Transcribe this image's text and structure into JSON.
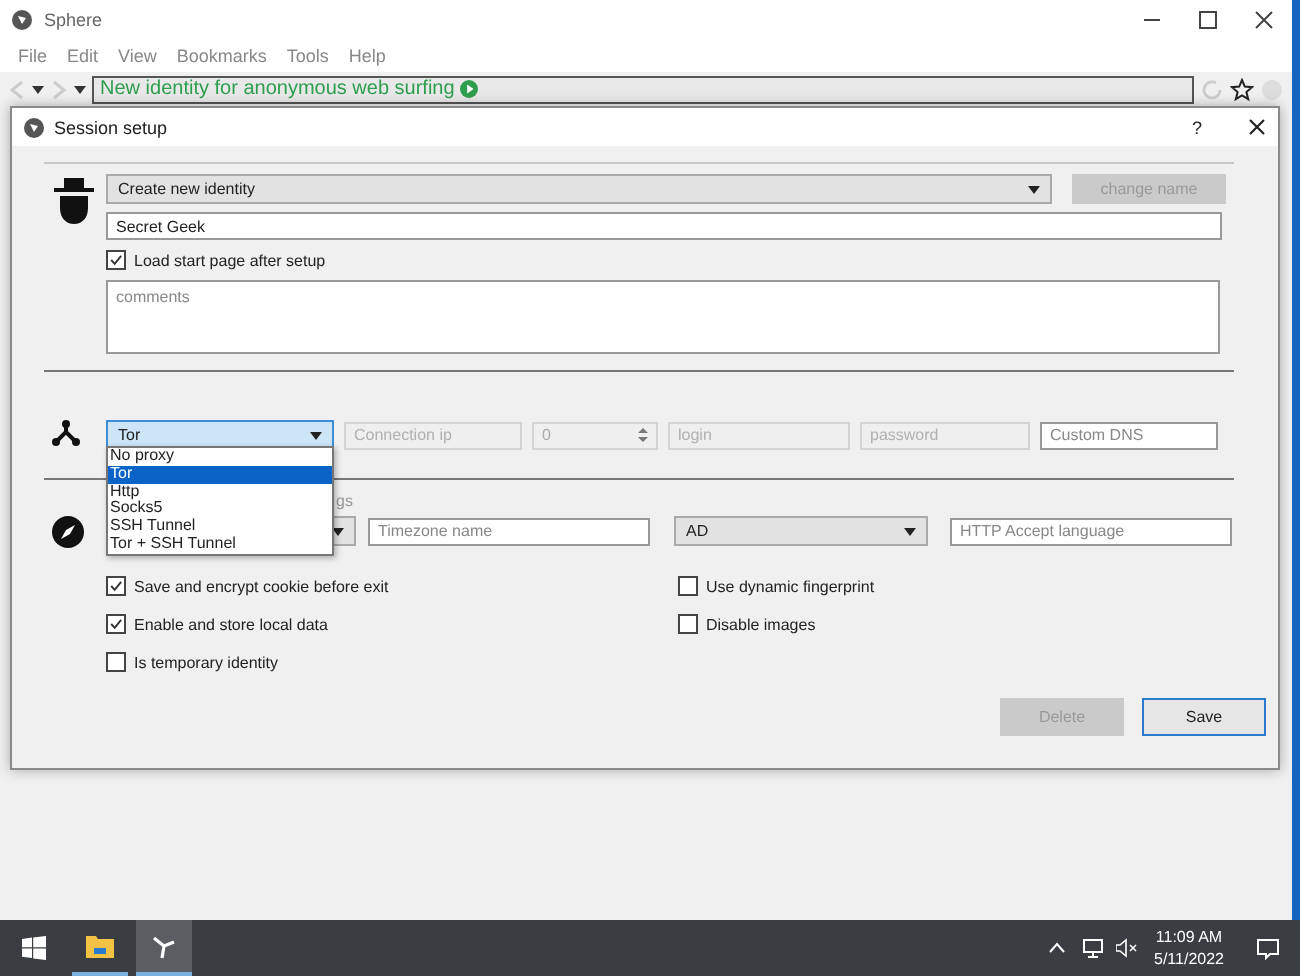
{
  "browser": {
    "title": "Sphere",
    "menu": [
      "File",
      "Edit",
      "View",
      "Bookmarks",
      "Tools",
      "Help"
    ],
    "address": "New identity for anonymous web surfing"
  },
  "dialog": {
    "title": "Session setup",
    "help": "?",
    "identity": {
      "mode": "Create new identity",
      "change_name": {
        "label": "change name",
        "disabled": true
      },
      "name": "Secret Geek",
      "load_start_page": {
        "label": "Load start page after setup",
        "checked": true
      },
      "comments_placeholder": "comments"
    },
    "proxy": {
      "type": "Tor",
      "options": [
        {
          "label": "No proxy",
          "selected": false
        },
        {
          "label": "Tor",
          "selected": true
        },
        {
          "label": "Http",
          "selected": false
        },
        {
          "label": "Socks5",
          "selected": false
        },
        {
          "label": "SSH Tunnel",
          "selected": false
        },
        {
          "label": "Tor + SSH Tunnel",
          "selected": false
        }
      ],
      "fields": [
        {
          "kind": "text",
          "placeholder": "Connection ip",
          "disabled": true
        },
        {
          "kind": "spin",
          "value": "0",
          "disabled": true
        },
        {
          "kind": "text",
          "placeholder": "login",
          "disabled": true
        },
        {
          "kind": "text",
          "placeholder": "password",
          "disabled": true
        },
        {
          "kind": "text",
          "placeholder": "Custom DNS",
          "disabled": false
        }
      ]
    },
    "geo": {
      "label": "gs",
      "timezone_placeholder": "Timezone name",
      "country": "AD",
      "language_placeholder": "HTTP Accept language"
    },
    "options": [
      {
        "label": "Save and encrypt cookie before exit",
        "checked": true
      },
      {
        "label": "Use dynamic fingerprint",
        "checked": false
      },
      {
        "label": "Enable and store local data",
        "checked": true
      },
      {
        "label": "Disable images",
        "checked": false
      },
      {
        "label": "Is temporary identity",
        "checked": false
      }
    ],
    "buttons": [
      {
        "label": "Delete",
        "disabled": true
      },
      {
        "label": "Save",
        "disabled": false
      }
    ]
  },
  "taskbar": {
    "time": "11:09 AM",
    "date": "5/11/2022"
  }
}
